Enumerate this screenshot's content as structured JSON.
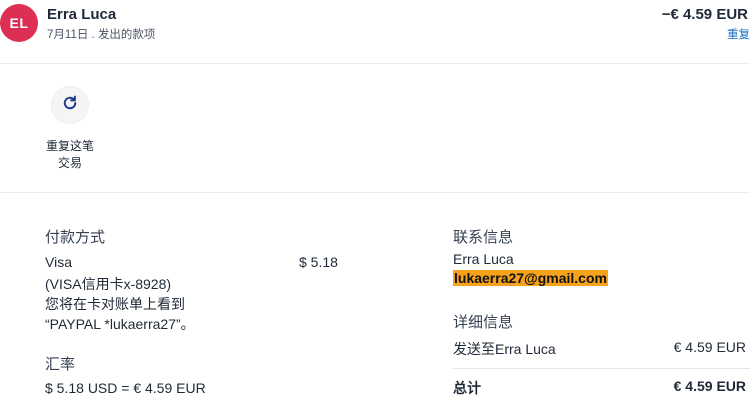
{
  "header": {
    "avatar_initials": "EL",
    "name": "Erra Luca",
    "subtitle": "7月11日 . 发出的款项",
    "amount": "−€ 4.59 EUR",
    "amount_link": "重复"
  },
  "action": {
    "icon": "refresh-icon",
    "label_line1": "重复这笔",
    "label_line2": "交易"
  },
  "payment": {
    "title": "付款方式",
    "method": "Visa",
    "card": "(VISA信用卡x-8928)",
    "statement_note": "您将在卡对账单上看到",
    "statement_name": "“PAYPAL *lukaerra27”。",
    "amount": "$ 5.18"
  },
  "exchange": {
    "title": "汇率",
    "value": "$ 5.18 USD = € 4.59 EUR"
  },
  "contact": {
    "title": "联系信息",
    "name": "Erra Luca",
    "email": "lukaerra27@gmail.com"
  },
  "details": {
    "title": "详细信息",
    "sent_to_label": "发送至Erra Luca",
    "sent_to_amount": "€ 4.59 EUR",
    "total_label": "总计",
    "total_amount": "€ 4.59 EUR"
  },
  "colors": {
    "avatar_bg": "#dc2f53",
    "link": "#1a6fc4",
    "email_highlight": "#f6a21b"
  }
}
